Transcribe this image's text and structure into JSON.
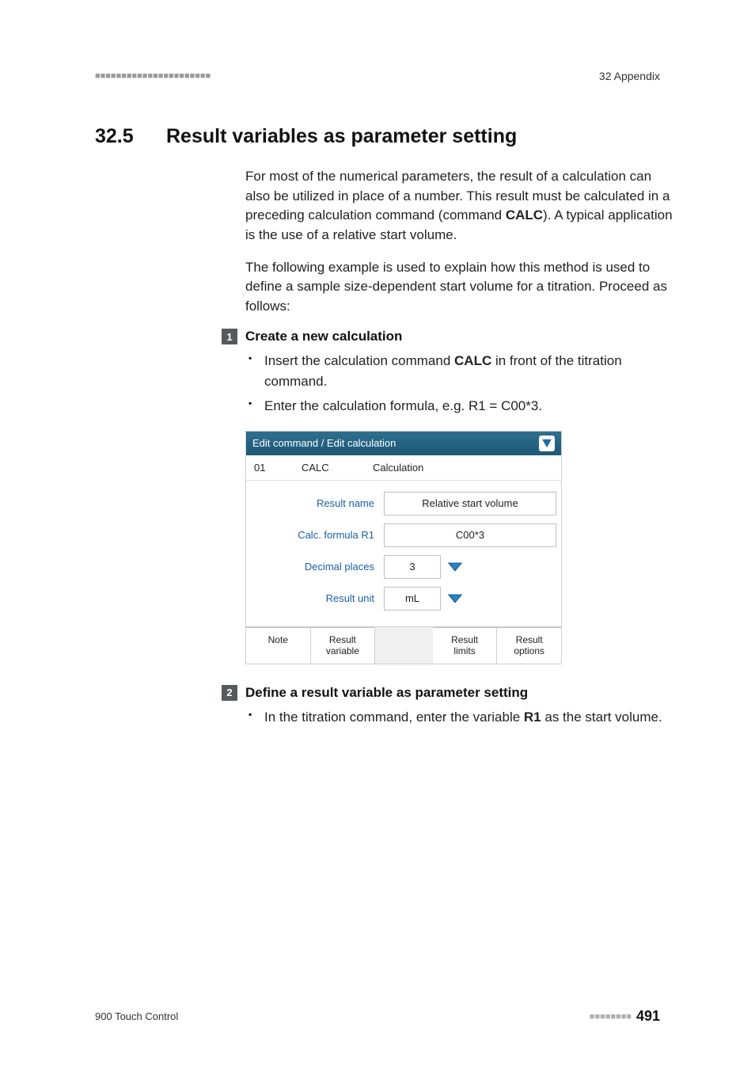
{
  "header": {
    "dashes": "■■■■■■■■■■■■■■■■■■■■■■",
    "appendix": "32 Appendix"
  },
  "section": {
    "num": "32.5",
    "title": "Result variables as parameter setting"
  },
  "para1": "For most of the numerical parameters, the result of a calculation can also be utilized in place of a number. This result must be calculated in a preceding calculation command (command ",
  "para1_bold": "CALC",
  "para1_tail": "). A typical application is the use of a relative start volume.",
  "para2": "The following example is used to explain how this method is used to define a sample size-dependent start volume for a titration. Proceed as follows:",
  "step1": {
    "num": "1",
    "title": "Create a new calculation",
    "b1_pre": "Insert the calculation command ",
    "b1_bold": "CALC",
    "b1_post": " in front of the titration command.",
    "b2": "Enter the calculation formula, e.g. R1 = C00*3."
  },
  "ui": {
    "titlebar": "Edit command / Edit calculation",
    "sub_id": "01",
    "sub_cmd": "CALC",
    "sub_label": "Calculation",
    "rows": {
      "result_name_label": "Result name",
      "result_name_value": "Relative start volume",
      "formula_label": "Calc. formula R1",
      "formula_value": "C00*3",
      "decimal_label": "Decimal places",
      "decimal_value": "3",
      "unit_label": "Result unit",
      "unit_value": "mL"
    },
    "bottom": {
      "note": "Note",
      "variable": "Result\nvariable",
      "limits": "Result\nlimits",
      "options": "Result\noptions"
    }
  },
  "step2": {
    "num": "2",
    "title": "Define a result variable as parameter setting",
    "b1_pre": "In the titration command, enter the variable ",
    "b1_bold": "R1",
    "b1_post": " as the start volume."
  },
  "footer": {
    "left": "900 Touch Control",
    "dashes": "■■■■■■■■",
    "page": "491"
  }
}
